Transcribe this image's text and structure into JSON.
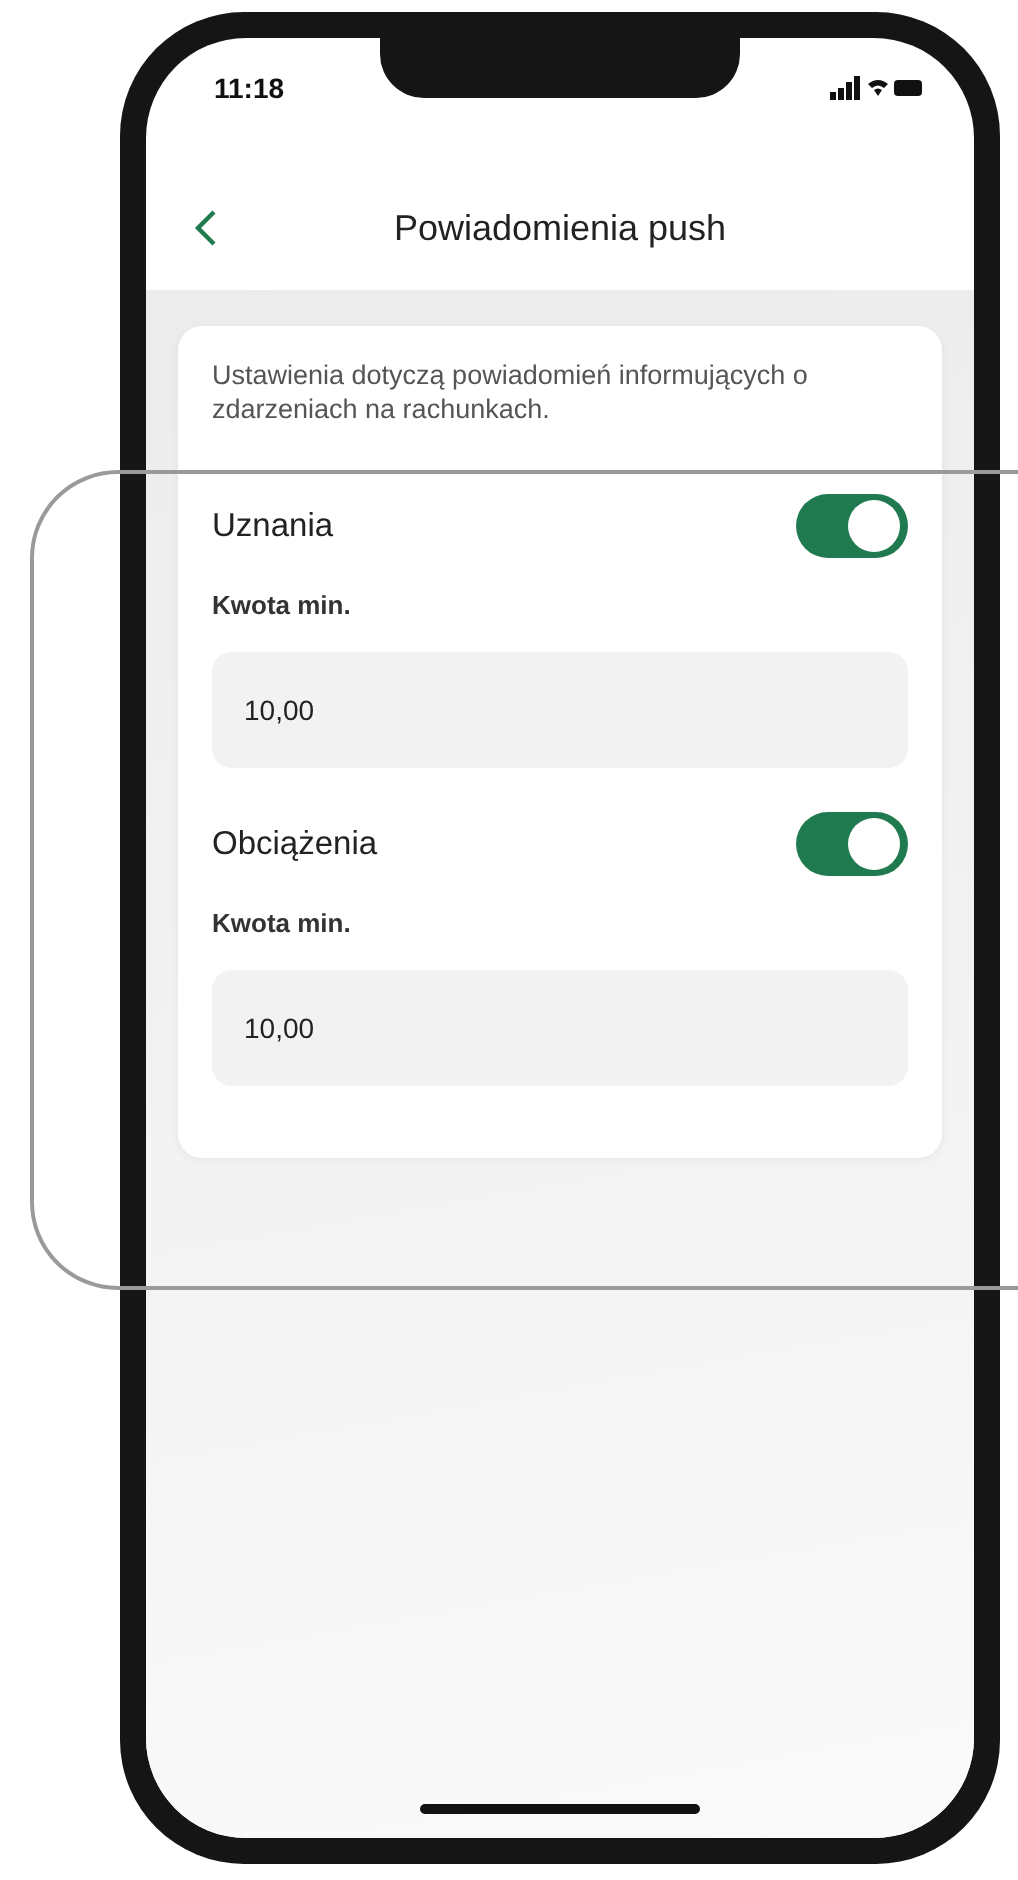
{
  "status_bar": {
    "time": "11:18"
  },
  "header": {
    "title": "Powiadomienia push"
  },
  "card": {
    "description": "Ustawienia dotyczą powiadomień informujących o zdarzeniach na rachunkach.",
    "sections": [
      {
        "title": "Uznania",
        "on": true,
        "amount_label": "Kwota min.",
        "amount": "10,00"
      },
      {
        "title": "Obciążenia",
        "on": true,
        "amount_label": "Kwota min.",
        "amount": "10,00"
      }
    ]
  }
}
